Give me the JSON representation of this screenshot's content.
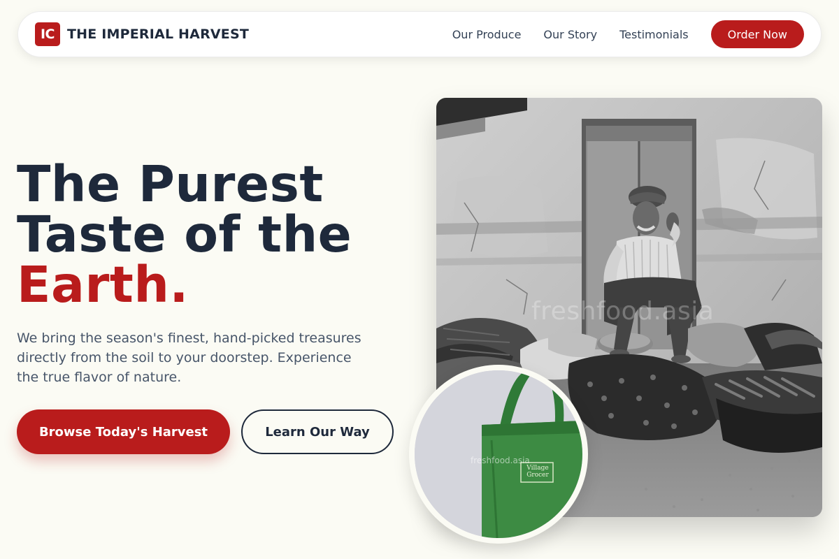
{
  "brand": {
    "logo_mark": "IC",
    "name": "THE IMPERIAL HARVEST"
  },
  "nav": {
    "links": [
      "Our Produce",
      "Our Story",
      "Testimonials"
    ],
    "cta": "Order Now"
  },
  "hero": {
    "title_line1": "The Purest",
    "title_line2": "Taste of the",
    "title_accent": "Earth.",
    "description": "We bring the season's finest, hand-picked treasures directly from the soil to your doorstep. Experience the true flavor of nature.",
    "primary_button": "Browse Today's Harvest",
    "secondary_button": "Learn Our Way"
  },
  "images": {
    "main_watermark": "freshfood.asia",
    "inset_watermark": "freshfood.asia",
    "bag_label_line1": "Village",
    "bag_label_line2": "Grocer"
  },
  "colors": {
    "accent": "#b91c1c",
    "ink": "#1e293b",
    "background": "#fbfbf4"
  },
  "icons": {
    "logo": "ic-logo-badge"
  }
}
